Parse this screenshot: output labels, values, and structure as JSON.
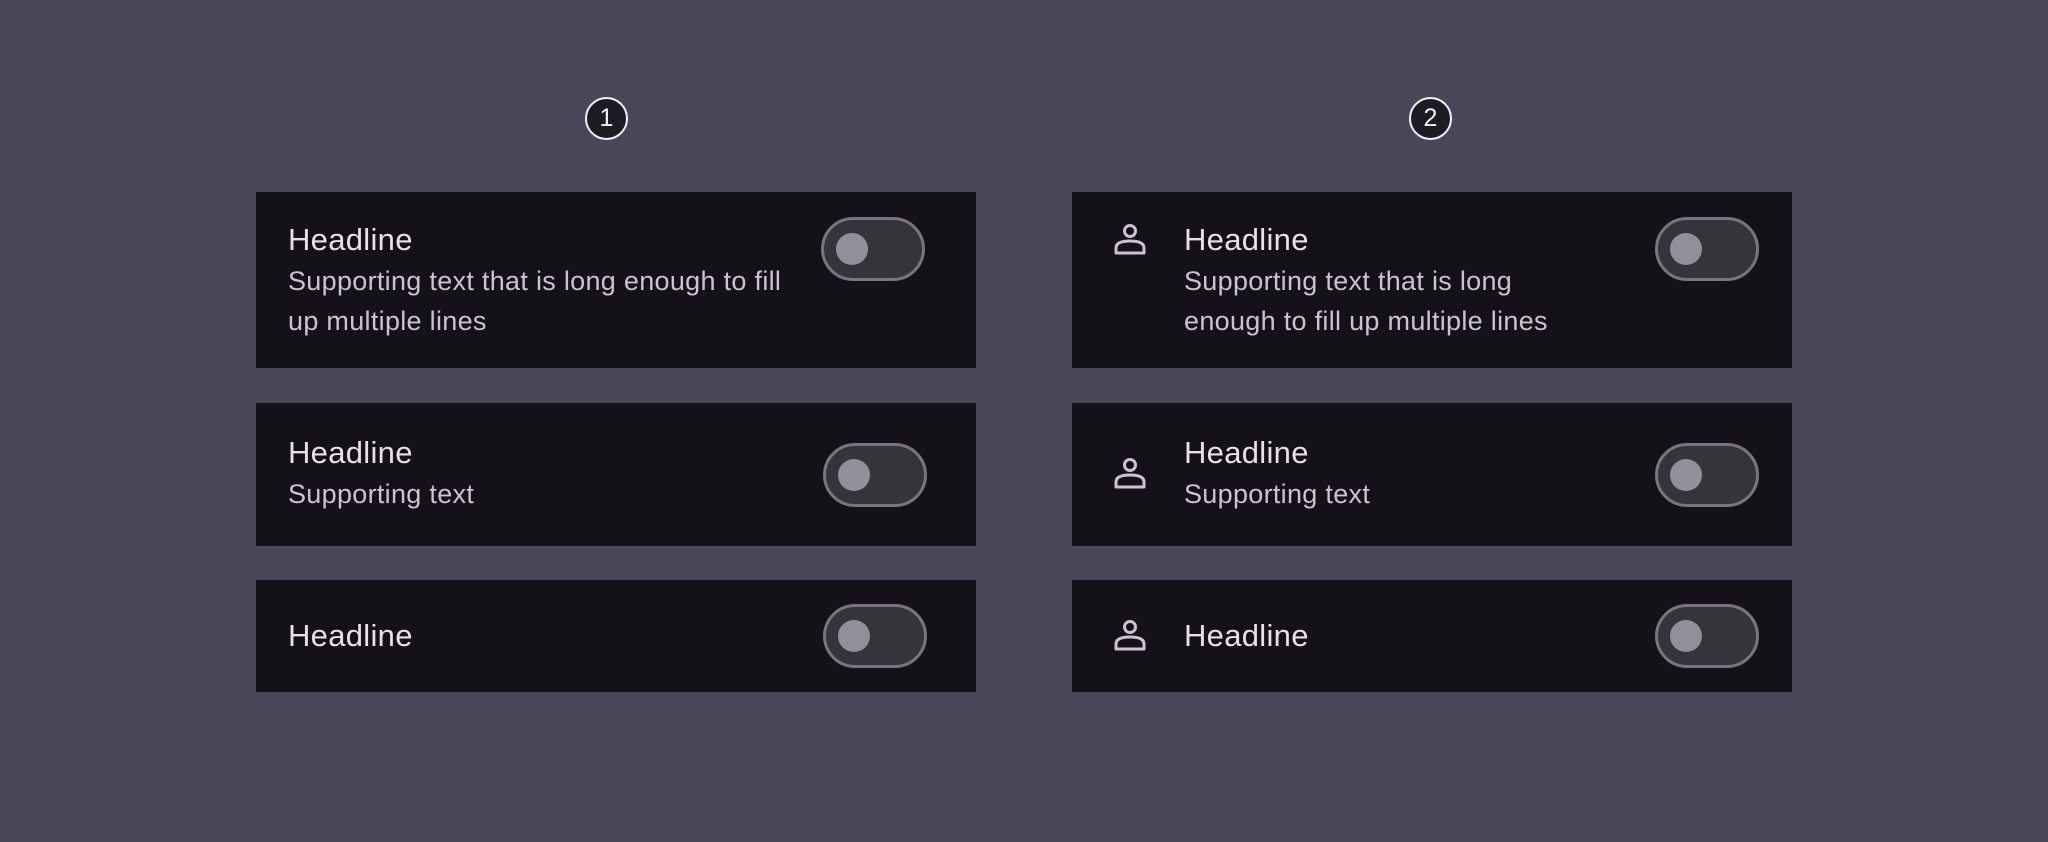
{
  "markers": [
    "1",
    "2"
  ],
  "columns": [
    {
      "with_leading_icon": false,
      "items": [
        {
          "headline": "Headline",
          "supporting": "Supporting text that is long enough to fill up multiple lines",
          "switch_on": false
        },
        {
          "headline": "Headline",
          "supporting": "Supporting text",
          "switch_on": false
        },
        {
          "headline": "Headline",
          "switch_on": false
        }
      ]
    },
    {
      "with_leading_icon": true,
      "leading_icon": "person-icon",
      "items": [
        {
          "headline": "Headline",
          "supporting": "Supporting text that is long enough to fill up multiple lines",
          "switch_on": false
        },
        {
          "headline": "Headline",
          "supporting": "Supporting text",
          "switch_on": false
        },
        {
          "headline": "Headline",
          "switch_on": false
        }
      ]
    }
  ],
  "colors": {
    "background": "#4a4559",
    "item_surface": "#141218",
    "headline_text": "#e6e0e9",
    "supporting_text": "#cac4d0",
    "switch_outline": "#79747e",
    "switch_track": "#36343b",
    "switch_thumb": "#938f99"
  }
}
